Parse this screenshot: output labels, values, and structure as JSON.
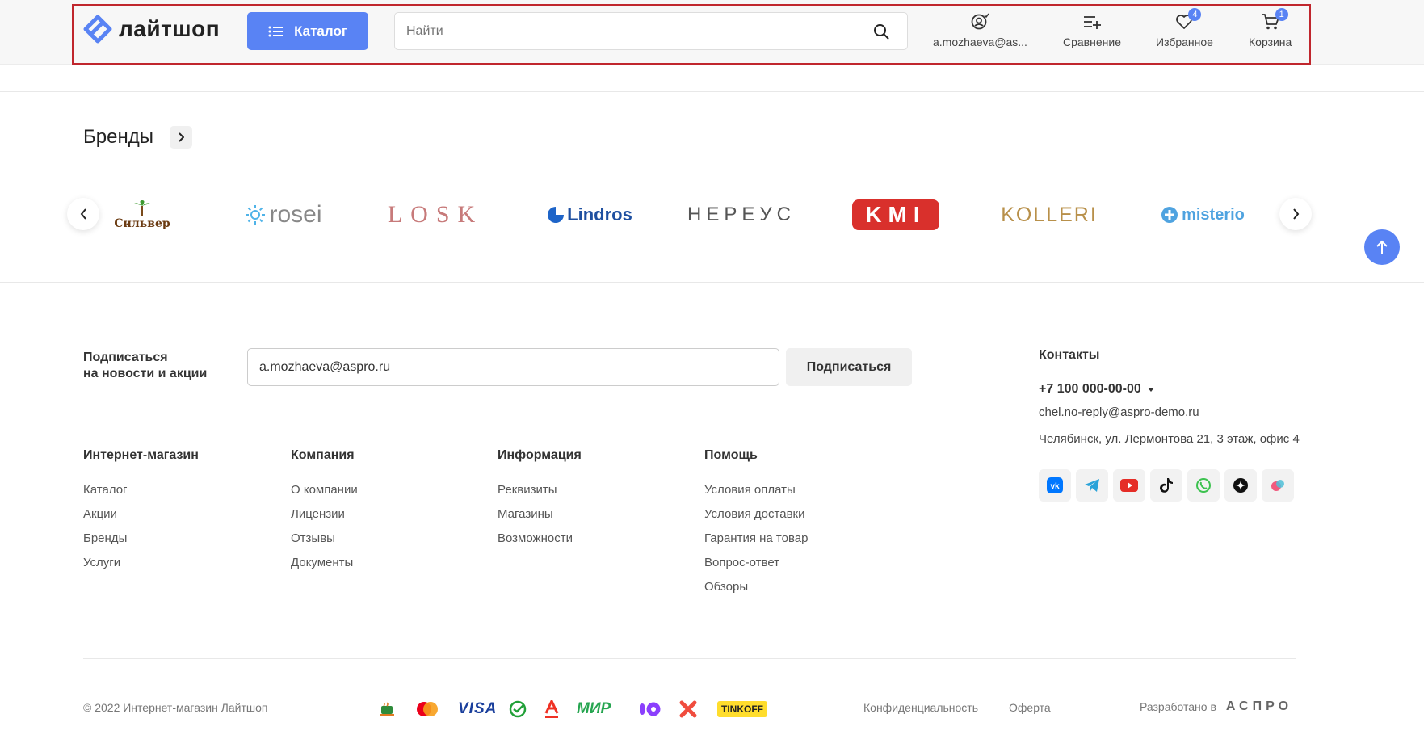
{
  "header": {
    "logo_text": "лайтшоп",
    "catalog_label": "Каталог",
    "search_placeholder": "Найти",
    "account_label": "a.mozhaeva@as...",
    "compare_label": "Сравнение",
    "favorites_label": "Избранное",
    "favorites_count": "4",
    "cart_label": "Корзина",
    "cart_count": "1",
    "accent_color": "#5983f4"
  },
  "brands": {
    "title": "Бренды",
    "items": [
      "Сильвер",
      "rosei",
      "LOSK",
      "Lindros",
      "НЕРЕУС",
      "KMI",
      "KOLLERI",
      "misterio"
    ]
  },
  "subscribe": {
    "label_line1": "Подписаться",
    "label_line2": "на новости и акции",
    "email_value": "a.mozhaeva@aspro.ru",
    "button_label": "Подписаться"
  },
  "footer_columns": [
    {
      "title": "Интернет-магазин",
      "links": [
        "Каталог",
        "Акции",
        "Бренды",
        "Услуги"
      ]
    },
    {
      "title": "Компания",
      "links": [
        "О компании",
        "Лицензии",
        "Отзывы",
        "Документы"
      ]
    },
    {
      "title": "Информация",
      "links": [
        "Реквизиты",
        "Магазины",
        "Возможности"
      ]
    },
    {
      "title": "Помощь",
      "links": [
        "Условия оплаты",
        "Условия доставки",
        "Гарантия на товар",
        "Вопрос-ответ",
        "Обзоры"
      ]
    }
  ],
  "contacts": {
    "title": "Контакты",
    "phone": "+7 100 000-00-00",
    "email": "chel.no-reply@aspro-demo.ru",
    "address": "Челябинск, ул. Лермонтова 21, 3 этаж, офис 4",
    "socials": [
      "vk-icon",
      "telegram-icon",
      "youtube-icon",
      "tiktok-icon",
      "whatsapp-icon",
      "zen-icon",
      "odnoklassniki-icon"
    ]
  },
  "bottom": {
    "copyright": "© 2022 Интернет-магазин Лайтшоп",
    "payments": [
      "cup-icon",
      "mastercard-icon",
      "VISA",
      "sber-icon",
      "alfa-icon",
      "МИР",
      "yoomoney-icon",
      "x-icon",
      "TINKOFF"
    ],
    "privacy": "Конфиденциальность",
    "offer": "Оферта",
    "developed_by": "Разработано в",
    "developer": "АСПРО"
  }
}
